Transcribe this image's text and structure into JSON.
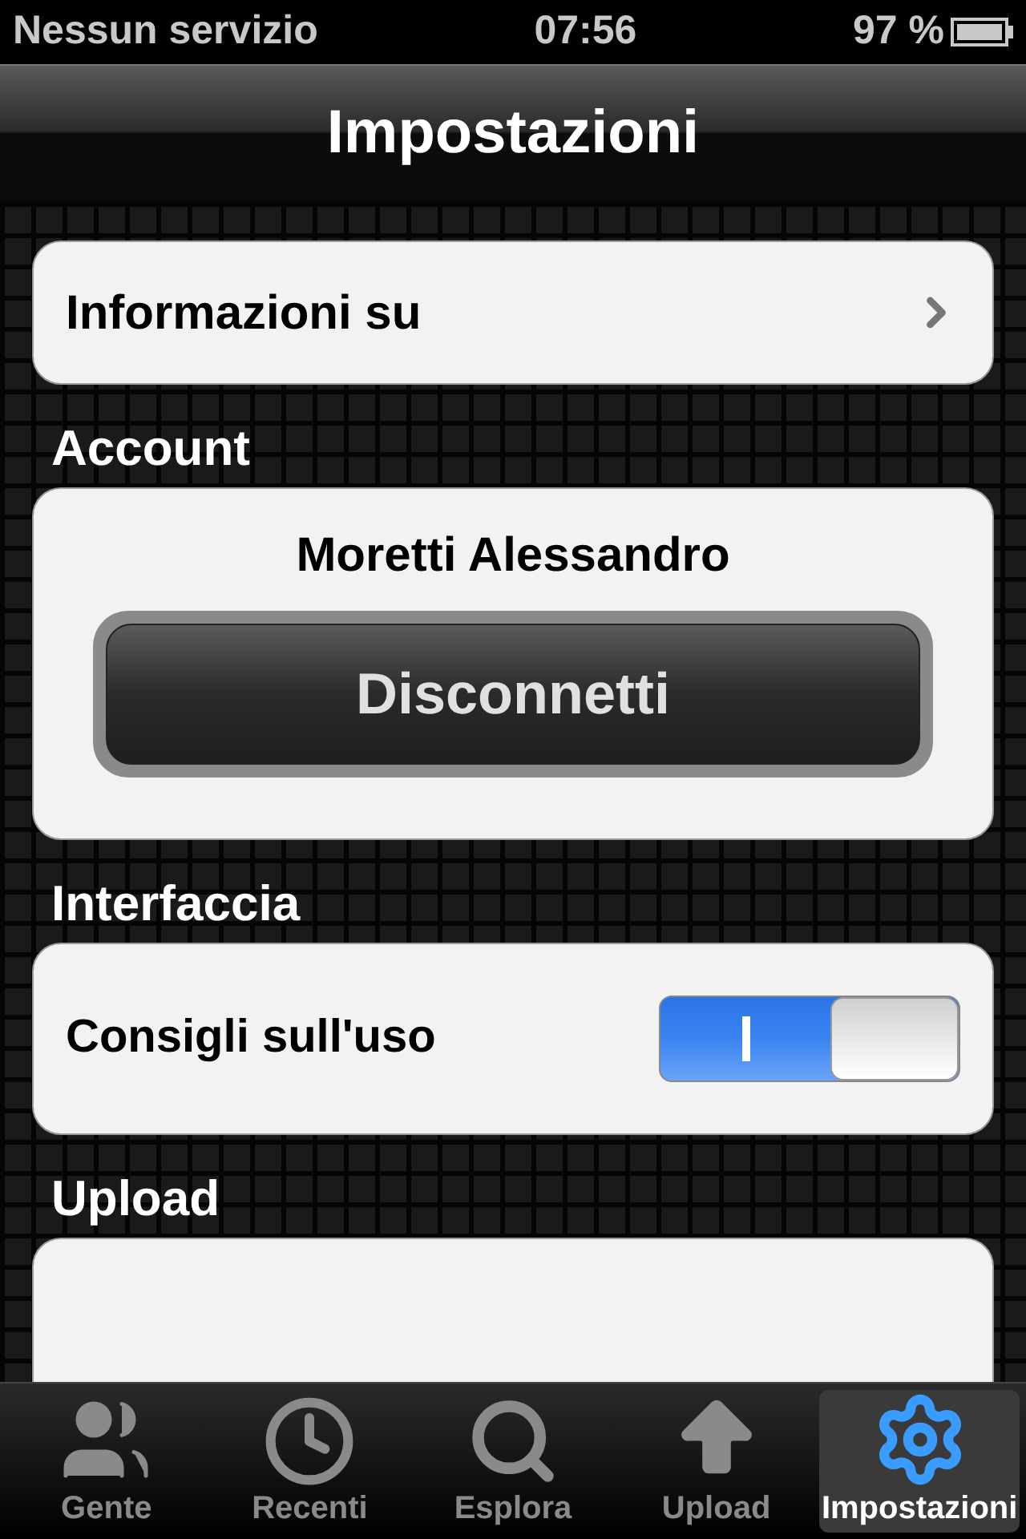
{
  "status_bar": {
    "carrier": "Nessun servizio",
    "time": "07:56",
    "battery": "97 %"
  },
  "nav_bar": {
    "title": "Impostazioni"
  },
  "sections": [
    {
      "kind": "link",
      "label": "Informazioni su"
    },
    {
      "kind": "account",
      "header": "Account",
      "name": "Moretti Alessandro",
      "button": "Disconnetti"
    },
    {
      "kind": "toggle",
      "header": "Interfaccia",
      "label": "Consigli sull'uso",
      "on": true
    },
    {
      "kind": "cut",
      "header": "Upload"
    }
  ],
  "tab_bar": [
    {
      "label": "Gente",
      "selected": false
    },
    {
      "label": "Recenti",
      "selected": false
    },
    {
      "label": "Esplora",
      "selected": false
    },
    {
      "label": "Upload",
      "selected": false
    },
    {
      "label": "Impostazioni",
      "selected": true
    }
  ]
}
